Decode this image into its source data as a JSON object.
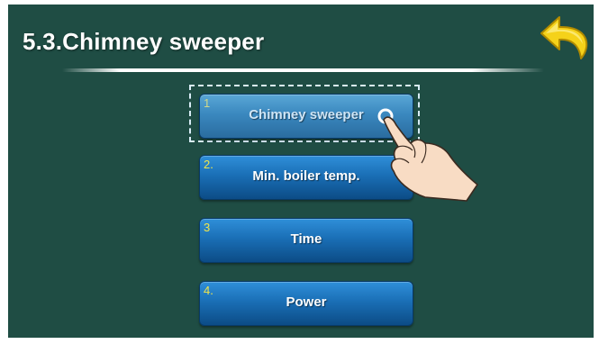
{
  "header": {
    "title": "5.3.Chimney sweeper"
  },
  "back_button": {
    "icon": "undo-arrow-icon",
    "color": "#f5d21a"
  },
  "menu": {
    "items": [
      {
        "number": "1",
        "label": "Chimney sweeper",
        "state": "pressed"
      },
      {
        "number": "2.",
        "label": "Min. boiler temp.",
        "state": "normal"
      },
      {
        "number": "3",
        "label": "Time",
        "state": "normal"
      },
      {
        "number": "4.",
        "label": "Power",
        "state": "normal"
      }
    ]
  },
  "colors": {
    "background": "#1f4d44",
    "button": "#1a6fb6",
    "button_pressed": "#3a88bf",
    "number": "#f2e64a"
  },
  "pointer": {
    "icon": "hand-pointer-icon"
  }
}
